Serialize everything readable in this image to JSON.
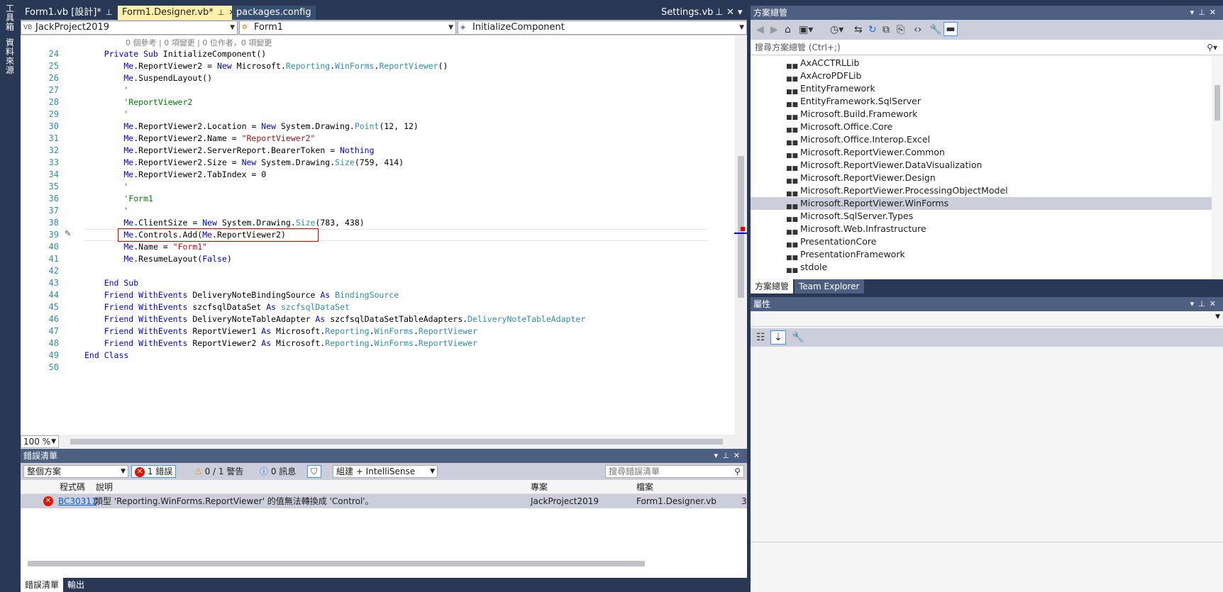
{
  "left_toolstrip": {
    "tabs": [
      "工具箱",
      "資料來源"
    ]
  },
  "doc_tabs": {
    "tabs": [
      {
        "label": "Form1.vb [設計]*",
        "active": false
      },
      {
        "label": "Form1.Designer.vb*",
        "active": true
      },
      {
        "label": "packages.config",
        "active": false
      }
    ],
    "right_tab": "Settings.vb"
  },
  "navbar": {
    "project": "JackProject2019",
    "class": "Form1",
    "member": "InitializeComponent"
  },
  "editor": {
    "codelens": "0 個參考 | 0 項變更 | 0 位作者，0 項變更",
    "zoom": "100 %",
    "lines": [
      {
        "n": "24",
        "tokens": [
          [
            "kw",
            "    Private Sub "
          ],
          [
            "",
            "InitializeComponent()"
          ]
        ]
      },
      {
        "n": "25",
        "tokens": [
          [
            "kw",
            "        Me"
          ],
          [
            "",
            ".ReportViewer2 = "
          ],
          [
            "kw",
            "New"
          ],
          [
            "",
            " Microsoft."
          ],
          [
            "ty",
            "Reporting"
          ],
          [
            "",
            "."
          ],
          [
            "ty",
            "WinForms"
          ],
          [
            "",
            "."
          ],
          [
            "ty",
            "ReportViewer"
          ],
          [
            "",
            "()"
          ]
        ]
      },
      {
        "n": "26",
        "tokens": [
          [
            "kw",
            "        Me"
          ],
          [
            "",
            ".SuspendLayout()"
          ]
        ]
      },
      {
        "n": "27",
        "tokens": [
          [
            "cm",
            "        '"
          ]
        ]
      },
      {
        "n": "28",
        "tokens": [
          [
            "cm",
            "        'ReportViewer2"
          ]
        ]
      },
      {
        "n": "29",
        "tokens": [
          [
            "cm",
            "        '"
          ]
        ]
      },
      {
        "n": "30",
        "tokens": [
          [
            "kw",
            "        Me"
          ],
          [
            "",
            ".ReportViewer2.Location = "
          ],
          [
            "kw",
            "New"
          ],
          [
            "",
            " System.Drawing."
          ],
          [
            "ty",
            "Point"
          ],
          [
            "",
            "(12, 12)"
          ]
        ]
      },
      {
        "n": "31",
        "tokens": [
          [
            "kw",
            "        Me"
          ],
          [
            "",
            ".ReportViewer2.Name = "
          ],
          [
            "st",
            "\"ReportViewer2\""
          ]
        ]
      },
      {
        "n": "32",
        "tokens": [
          [
            "kw",
            "        Me"
          ],
          [
            "",
            ".ReportViewer2.ServerReport.BearerToken = "
          ],
          [
            "kw",
            "Nothing"
          ]
        ]
      },
      {
        "n": "33",
        "tokens": [
          [
            "kw",
            "        Me"
          ],
          [
            "",
            ".ReportViewer2.Size = "
          ],
          [
            "kw",
            "New"
          ],
          [
            "",
            " System.Drawing."
          ],
          [
            "ty",
            "Size"
          ],
          [
            "",
            "(759, 414)"
          ]
        ]
      },
      {
        "n": "34",
        "tokens": [
          [
            "kw",
            "        Me"
          ],
          [
            "",
            ".ReportViewer2.TabIndex = 0"
          ]
        ]
      },
      {
        "n": "35",
        "tokens": [
          [
            "cm",
            "        '"
          ]
        ]
      },
      {
        "n": "36",
        "tokens": [
          [
            "cm",
            "        'Form1"
          ]
        ]
      },
      {
        "n": "37",
        "tokens": [
          [
            "cm",
            "        '"
          ]
        ]
      },
      {
        "n": "38",
        "tokens": [
          [
            "kw",
            "        Me"
          ],
          [
            "",
            ".ClientSize = "
          ],
          [
            "kw",
            "New"
          ],
          [
            "",
            " System.Drawing."
          ],
          [
            "ty",
            "Size"
          ],
          [
            "",
            "(783, 438)"
          ]
        ]
      },
      {
        "n": "39",
        "tokens": [
          [
            "kw",
            "        Me"
          ],
          [
            "",
            ".Controls.Add("
          ],
          [
            "kw",
            "Me"
          ],
          [
            "",
            ".ReportViewer2)"
          ]
        ]
      },
      {
        "n": "40",
        "tokens": [
          [
            "kw",
            "        Me"
          ],
          [
            "",
            ".Name = "
          ],
          [
            "st",
            "\"Form1\""
          ]
        ]
      },
      {
        "n": "41",
        "tokens": [
          [
            "kw",
            "        Me"
          ],
          [
            "",
            ".ResumeLayout("
          ],
          [
            "kw",
            "False"
          ],
          [
            "",
            ")"
          ]
        ]
      },
      {
        "n": "42",
        "tokens": [
          [
            "",
            ""
          ]
        ]
      },
      {
        "n": "43",
        "tokens": [
          [
            "kw",
            "    End Sub"
          ]
        ]
      },
      {
        "n": "44",
        "tokens": [
          [
            "kw",
            "    Friend WithEvents "
          ],
          [
            "",
            "DeliveryNoteBindingSource "
          ],
          [
            "kw",
            "As "
          ],
          [
            "ty",
            "BindingSource"
          ]
        ]
      },
      {
        "n": "45",
        "tokens": [
          [
            "kw",
            "    Friend WithEvents "
          ],
          [
            "",
            "szcfsqlDataSet "
          ],
          [
            "kw",
            "As "
          ],
          [
            "ty",
            "szcfsqlDataSet"
          ]
        ]
      },
      {
        "n": "46",
        "tokens": [
          [
            "kw",
            "    Friend WithEvents "
          ],
          [
            "",
            "DeliveryNoteTableAdapter "
          ],
          [
            "kw",
            "As "
          ],
          [
            "",
            "szcfsqlDataSetTableAdapters."
          ],
          [
            "ty",
            "DeliveryNoteTableAdapter"
          ]
        ]
      },
      {
        "n": "47",
        "tokens": [
          [
            "kw",
            "    Friend WithEvents "
          ],
          [
            "",
            "ReportViewer1 "
          ],
          [
            "kw",
            "As "
          ],
          [
            "",
            "Microsoft."
          ],
          [
            "ty",
            "Reporting"
          ],
          [
            "",
            "."
          ],
          [
            "ty",
            "WinForms"
          ],
          [
            "",
            "."
          ],
          [
            "ty",
            "ReportViewer"
          ]
        ]
      },
      {
        "n": "48",
        "tokens": [
          [
            "kw",
            "    Friend WithEvents "
          ],
          [
            "",
            "ReportViewer2 "
          ],
          [
            "kw",
            "As "
          ],
          [
            "",
            "Microsoft."
          ],
          [
            "ty",
            "Reporting"
          ],
          [
            "",
            "."
          ],
          [
            "ty",
            "WinForms"
          ],
          [
            "",
            "."
          ],
          [
            "ty",
            "ReportViewer"
          ]
        ]
      },
      {
        "n": "49",
        "tokens": [
          [
            "kw",
            "End Class"
          ]
        ]
      },
      {
        "n": "50",
        "tokens": [
          [
            "",
            ""
          ]
        ]
      }
    ]
  },
  "error_list": {
    "title": "錯誤清單",
    "scope": "整個方案",
    "errors_btn": "1 錯誤",
    "warnings_btn": "0 / 1 警告",
    "messages_btn": "0 訊息",
    "build_filter": "組建 + IntelliSense",
    "search_placeholder": "搜尋錯誤清單",
    "columns": [
      "程式碼",
      "說明",
      "專案",
      "檔案"
    ],
    "rows": [
      {
        "code": "BC30311",
        "description": "類型 'Reporting.WinForms.ReportViewer' 的值無法轉換成 'Control'。",
        "project": "JackProject2019",
        "file": "Form1.Designer.vb",
        "line": "3"
      }
    ],
    "bottom_tabs": [
      "錯誤清單",
      "輸出"
    ]
  },
  "solution_explorer": {
    "title": "方案總管",
    "search_placeholder": "搜尋方案總管 (Ctrl+;)",
    "items": [
      "AxACCTRLLib",
      "AxAcroPDFLib",
      "EntityFramework",
      "EntityFramework.SqlServer",
      "Microsoft.Build.Framework",
      "Microsoft.Office.Core",
      "Microsoft.Office.Interop.Excel",
      "Microsoft.ReportViewer.Common",
      "Microsoft.ReportViewer.DataVisualization",
      "Microsoft.ReportViewer.Design",
      "Microsoft.ReportViewer.ProcessingObjectModel",
      "Microsoft.ReportViewer.WinForms",
      "Microsoft.SqlServer.Types",
      "Microsoft.Web.Infrastructure",
      "PresentationCore",
      "PresentationFramework",
      "stdole"
    ],
    "selected_index": 11,
    "tabs": [
      "方案總管",
      "Team Explorer"
    ]
  },
  "properties": {
    "title": "屬性"
  },
  "colors": {
    "accent": "#fff1a8",
    "frame": "#293955",
    "error": "#e51400"
  }
}
